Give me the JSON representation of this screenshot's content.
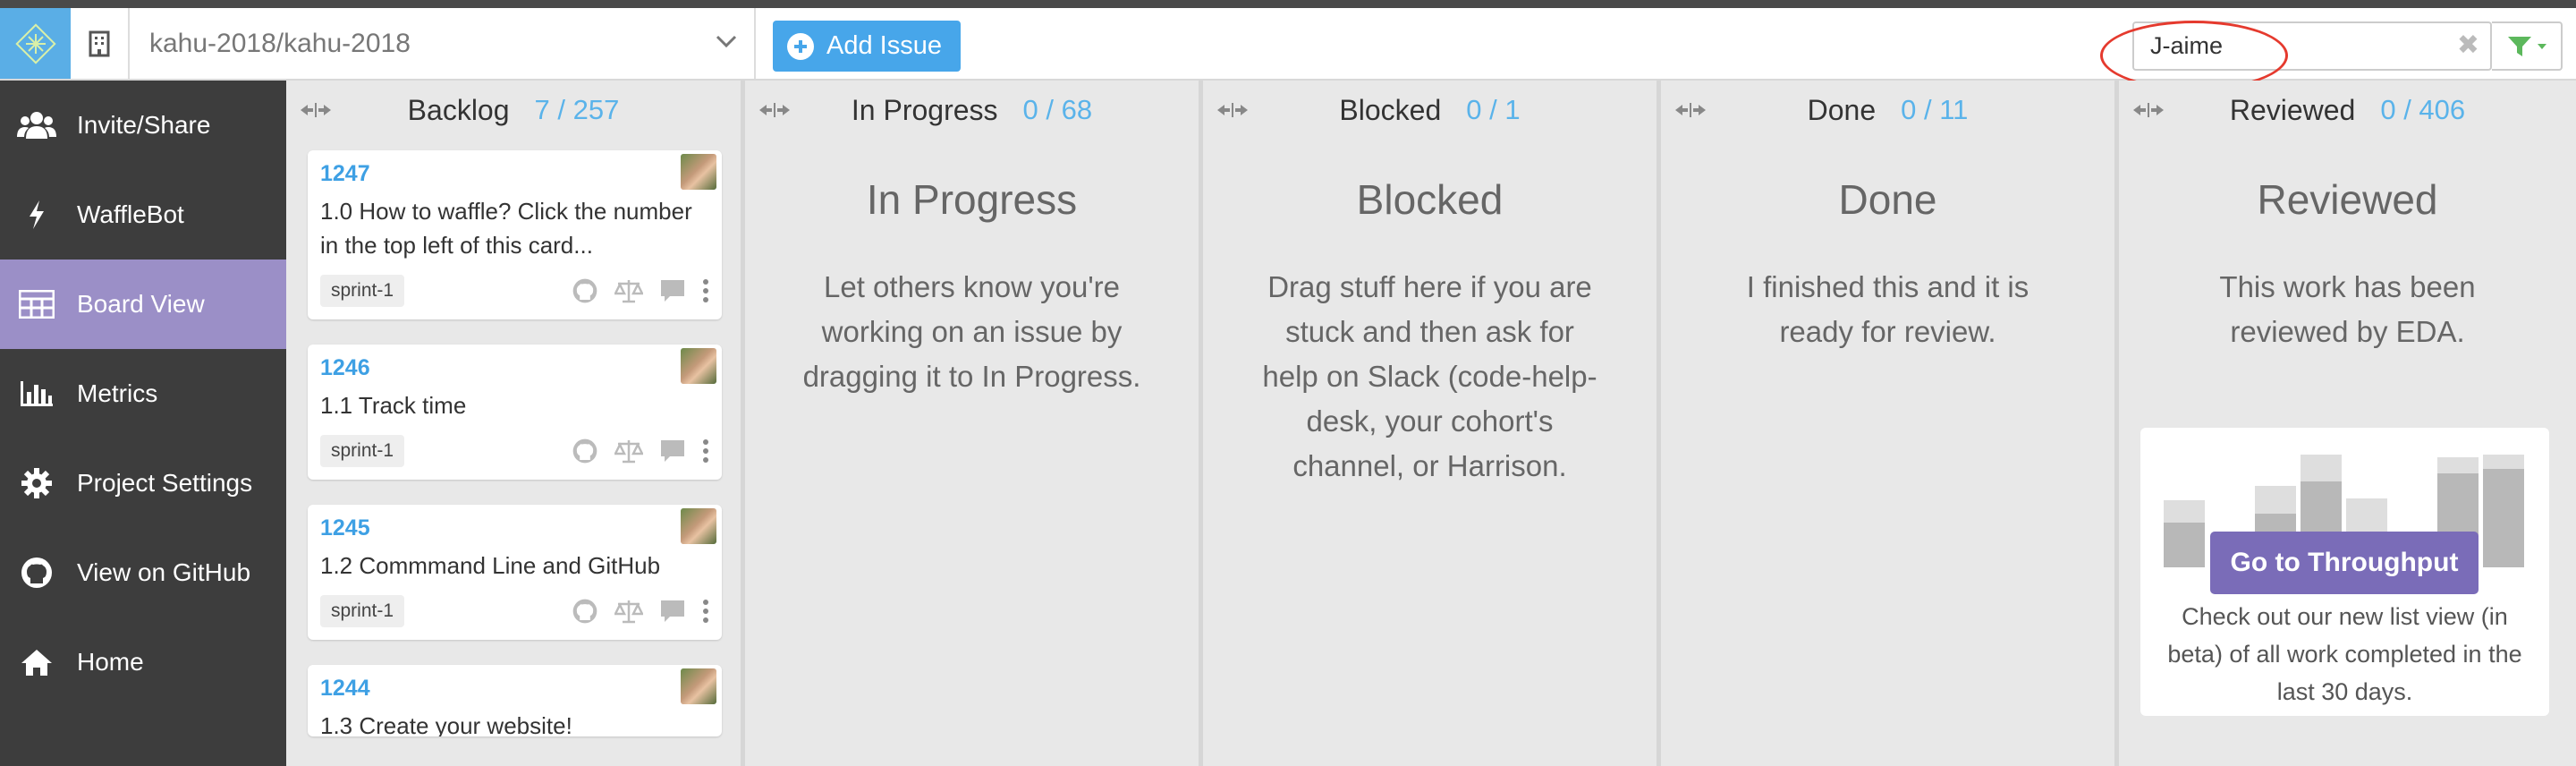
{
  "header": {
    "repo": "kahu-2018/kahu-2018",
    "add_issue_label": "Add Issue",
    "search_value": "J-aime"
  },
  "sidebar": {
    "items": [
      {
        "label": "Invite/Share",
        "icon": "users-icon"
      },
      {
        "label": "WaffleBot",
        "icon": "bolt-icon"
      },
      {
        "label": "Board View",
        "icon": "table-icon",
        "active": true
      },
      {
        "label": "Metrics",
        "icon": "bar-chart-icon"
      },
      {
        "label": "Project Settings",
        "icon": "gear-icon"
      },
      {
        "label": "View on GitHub",
        "icon": "github-icon"
      },
      {
        "label": "Home",
        "icon": "home-icon"
      }
    ]
  },
  "columns": [
    {
      "title": "Backlog",
      "count": "7 / 257"
    },
    {
      "title": "In Progress",
      "count": "0 / 68",
      "empty_title": "In Progress",
      "empty_text": "Let others know you're working on an issue by dragging it to In Progress."
    },
    {
      "title": "Blocked",
      "count": "0 / 1",
      "empty_title": "Blocked",
      "empty_text": "Drag stuff here if you are stuck and then ask for help on Slack (code-help-desk, your cohort's channel, or Harrison."
    },
    {
      "title": "Done",
      "count": "0 / 11",
      "empty_title": "Done",
      "empty_text": "I finished this and it is ready for review."
    },
    {
      "title": "Reviewed",
      "count": "0 / 406",
      "empty_title": "Reviewed",
      "empty_text": "This work has been reviewed by EDA."
    }
  ],
  "cards": [
    {
      "number": "1247",
      "title": "1.0 How to waffle? Click the number in the top left of this card...",
      "tag": "sprint-1"
    },
    {
      "number": "1246",
      "title": "1.1 Track time",
      "tag": "sprint-1"
    },
    {
      "number": "1245",
      "title": "1.2 Commmand Line and GitHub",
      "tag": "sprint-1"
    },
    {
      "number": "1244",
      "title": "1.3 Create your website!",
      "tag": ""
    }
  ],
  "throughput": {
    "button_label": "Go to Throughput",
    "text": "Check out our new list view (in beta) of all work completed in the last 30 days."
  },
  "colors": {
    "accent": "#47a6ea",
    "sidebar_bg": "#3d3d3d",
    "sidebar_active": "#9b8fc7",
    "throughput_button": "#7a6cb8",
    "filter_icon": "#5cb85c",
    "highlight_circle": "#e53a2e"
  }
}
